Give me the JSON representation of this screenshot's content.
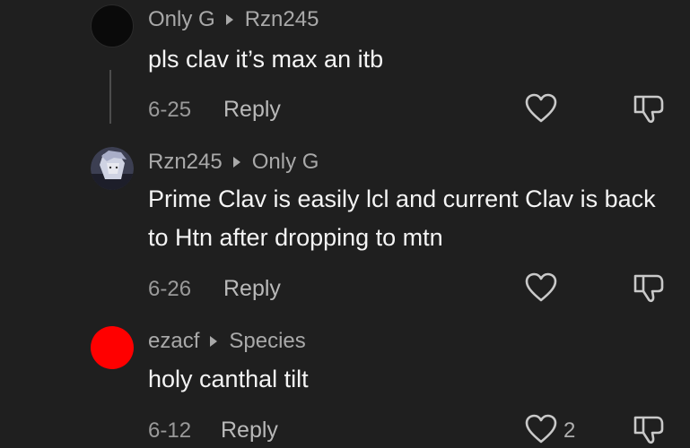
{
  "comments": [
    {
      "author": "Only G",
      "reply_to": "Rzn245",
      "text": "pls clav it’s max an itb",
      "date": "6-25",
      "reply_label": "Reply",
      "avatar_color": "#0a0a0a",
      "like_count": ""
    },
    {
      "author": "Rzn245",
      "reply_to": "Only G",
      "text": "Prime Clav is easily lcl and current Clav is back to Htn after dropping to mtn",
      "date": "6-26",
      "reply_label": "Reply",
      "avatar_color": "#8a8fa6",
      "like_count": ""
    },
    {
      "author": "ezacf",
      "reply_to": "Species",
      "text": "holy canthal tilt",
      "date": "6-12",
      "reply_label": "Reply",
      "avatar_color": "#ff0000",
      "like_count": "2"
    }
  ],
  "icons": {
    "like": "heart-icon",
    "dislike": "thumbs-down-icon",
    "reply_to": "triangle-right-icon"
  }
}
